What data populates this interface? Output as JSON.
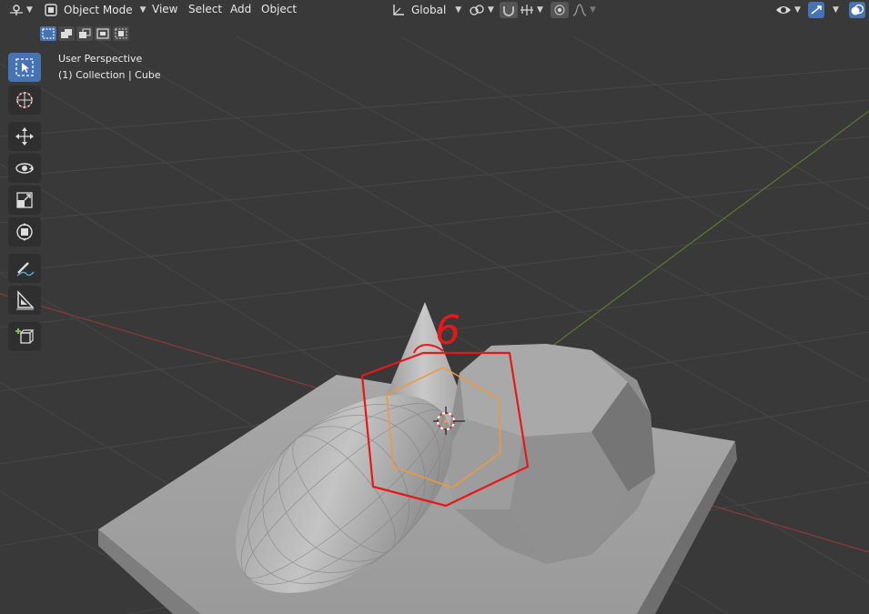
{
  "header": {
    "editor_type_icon": "3d-viewport-icon",
    "mode_label": "Object Mode",
    "menus": [
      "View",
      "Select",
      "Add",
      "Object"
    ],
    "transform_orientation": "Global"
  },
  "viewport": {
    "perspective_label": "User Perspective",
    "object_info": "(1) Collection | Cube",
    "annotation_number": "6"
  },
  "toolbar": {
    "tools": [
      {
        "name": "select-box",
        "icon": "select-box-icon",
        "active": true
      },
      {
        "name": "cursor",
        "icon": "cursor-icon",
        "active": false
      },
      {
        "name": "move",
        "icon": "move-icon",
        "active": false
      },
      {
        "name": "rotate",
        "icon": "rotate-icon",
        "active": false
      },
      {
        "name": "scale",
        "icon": "scale-icon",
        "active": false
      },
      {
        "name": "transform",
        "icon": "transform-icon",
        "active": false
      },
      {
        "name": "annotate",
        "icon": "annotate-icon",
        "active": false
      },
      {
        "name": "measure",
        "icon": "measure-icon",
        "active": false
      },
      {
        "name": "add-cube",
        "icon": "add-cube-icon",
        "active": false
      }
    ]
  },
  "colors": {
    "background": "#3a3a3a",
    "grid": "#444444",
    "x_axis": "#8b3a3a",
    "y_axis": "#5c7a2a",
    "selection_outline": "#f0983a",
    "annotation": "#e81818",
    "active_tool": "#4772b3"
  }
}
